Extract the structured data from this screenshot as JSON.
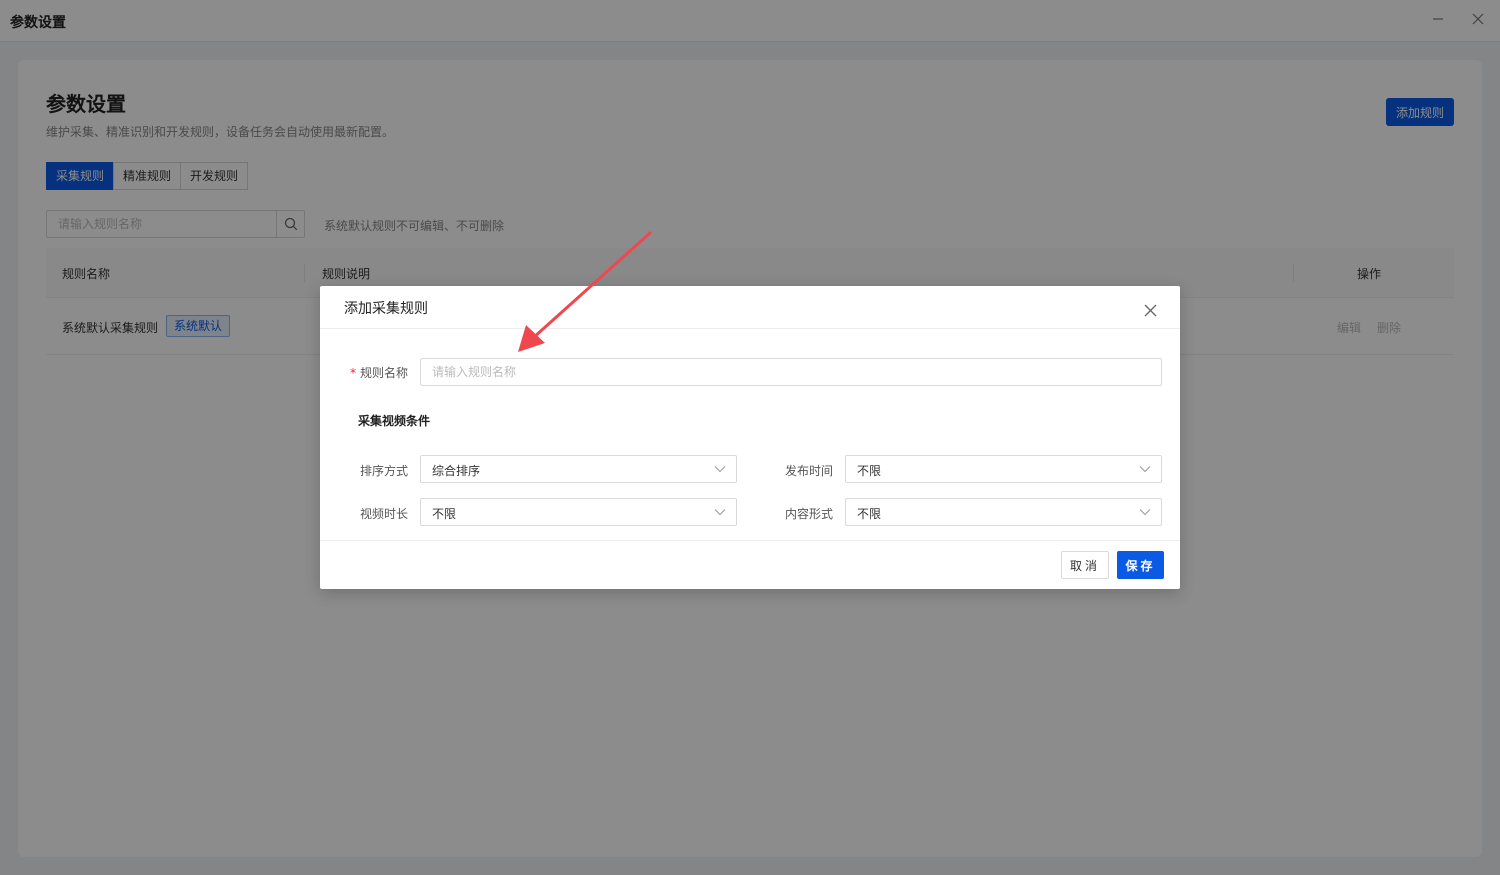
{
  "window": {
    "title": "参数设置"
  },
  "page": {
    "title": "参数设置",
    "description": "维护采集、精准识别和开发规则，设备任务会自动使用最新配置。",
    "add_rule_label": "添加规则",
    "tabs": [
      {
        "label": "采集规则",
        "active": true
      },
      {
        "label": "精准规则",
        "active": false
      },
      {
        "label": "开发规则",
        "active": false
      }
    ],
    "search": {
      "placeholder": "请输入规则名称"
    },
    "hint": "系统默认规则不可编辑、不可删除",
    "table": {
      "columns": [
        "规则名称",
        "规则说明",
        "操作"
      ],
      "rows": [
        {
          "name": "系统默认采集规则",
          "badge": "系统默认",
          "actions": [
            "编辑",
            "删除"
          ]
        }
      ]
    }
  },
  "modal": {
    "title": "添加采集规则",
    "name_field": {
      "label": "规则名称",
      "required_mark": "*",
      "placeholder": "请输入规则名称"
    },
    "section_title": "采集视频条件",
    "fields": [
      {
        "label": "排序方式",
        "value": "综合排序"
      },
      {
        "label": "发布时间",
        "value": "不限"
      },
      {
        "label": "视频时长",
        "value": "不限"
      },
      {
        "label": "内容形式",
        "value": "不限"
      }
    ],
    "cancel_label": "取消",
    "save_label": "保存"
  },
  "colors": {
    "primary": "#0a5ae6",
    "required": "#f5222d",
    "arrow": "#f0474f"
  }
}
